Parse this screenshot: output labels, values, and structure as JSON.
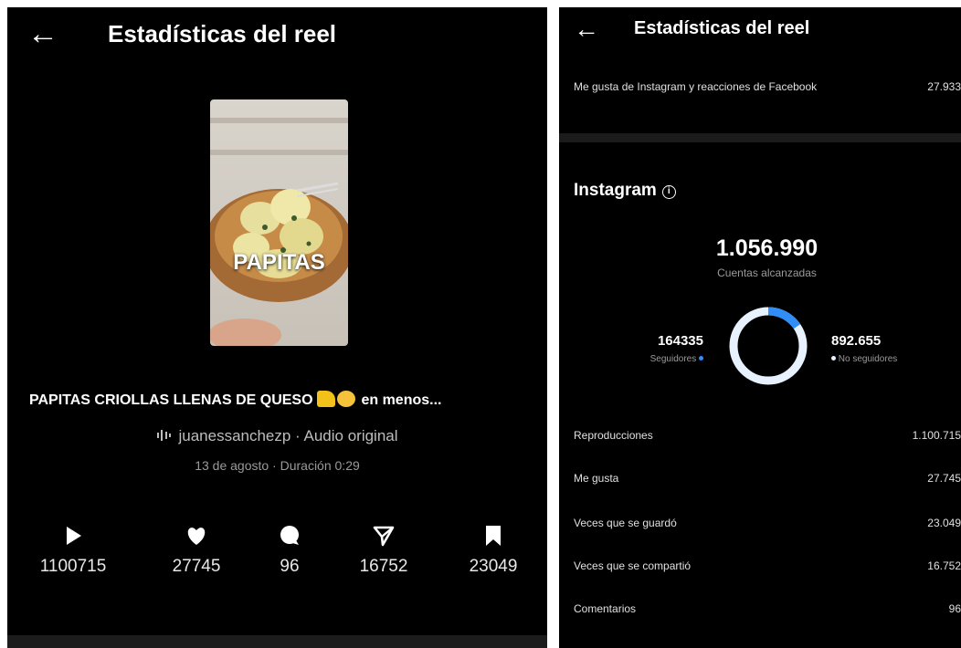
{
  "colors": {
    "accent_blue": "#2f8ef7",
    "donut_rest": "#e8f2fe",
    "background": "#000000"
  },
  "left": {
    "back_icon": "arrow-left-icon",
    "title": "Estadísticas del reel",
    "thumbnail_text": "PAPITAS",
    "reel_title": "PAPITAS CRIOLLAS LLENAS DE QUESO",
    "reel_title_suffix": "en menos...",
    "audio_icon": "audio-waveform-icon",
    "audio_text": "juanessanchezp · Audio original",
    "date_text": "13 de agosto · Duración 0:29",
    "stats": [
      {
        "icon": "play-icon",
        "value": "1100715"
      },
      {
        "icon": "heart-icon",
        "value": "27745"
      },
      {
        "icon": "comment-icon",
        "value": "96"
      },
      {
        "icon": "share-icon",
        "value": "16752"
      },
      {
        "icon": "bookmark-icon",
        "value": "23049"
      }
    ]
  },
  "right": {
    "back_icon": "arrow-left-icon",
    "title": "Estadísticas del reel",
    "likes_label": "Me gusta de Instagram y reacciones de Facebook",
    "likes_value": "27.933",
    "instagram_heading": "Instagram",
    "info_icon": "info-icon",
    "accounts_reached": "1.056.990",
    "accounts_reached_label": "Cuentas alcanzadas",
    "followers_value": "164335",
    "followers_label": "Seguidores",
    "non_followers_value": "892.655",
    "non_followers_label": "No seguidores",
    "followers_fraction": 0.155,
    "metrics": [
      {
        "label": "Reproducciones",
        "value": "1.100.715"
      },
      {
        "label": "Me gusta",
        "value": "27.745"
      },
      {
        "label": "Veces que se guardó",
        "value": "23.049"
      },
      {
        "label": "Veces que se compartió",
        "value": "16.752"
      },
      {
        "label": "Comentarios",
        "value": "96"
      }
    ]
  }
}
